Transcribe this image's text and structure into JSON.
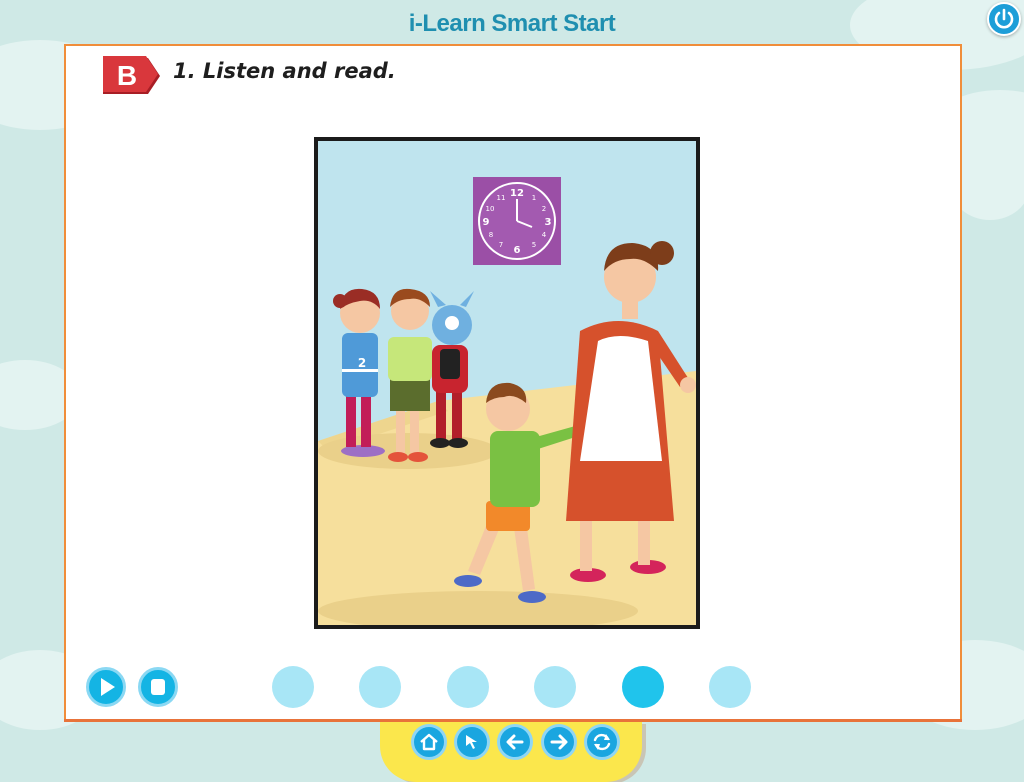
{
  "app": {
    "title": "i-Learn Smart Start"
  },
  "section": {
    "badge_letter": "B",
    "instruction": "1. Listen and read."
  },
  "scene": {
    "shirt_number": "2",
    "clock_numbers": [
      "12",
      "1",
      "2",
      "3",
      "4",
      "5",
      "6",
      "7",
      "8",
      "9",
      "10",
      "11"
    ]
  },
  "player": {
    "icons": {
      "play": "play-icon",
      "stop": "stop-icon"
    },
    "dot_count": 6,
    "active_dot_index": 4
  },
  "nav": {
    "icons": [
      "home-icon",
      "cursor-icon",
      "arrow-left-icon",
      "arrow-right-icon",
      "refresh-icon"
    ]
  },
  "colors": {
    "background": "#cfe9e6",
    "title": "#1f8fb0",
    "panel_border": "#f08d3a",
    "badge": "#d32f36",
    "button": "#14b4e4",
    "dot": "#a8e6f6",
    "dot_active": "#20c4ec",
    "nav_bar": "#fbe74c"
  }
}
